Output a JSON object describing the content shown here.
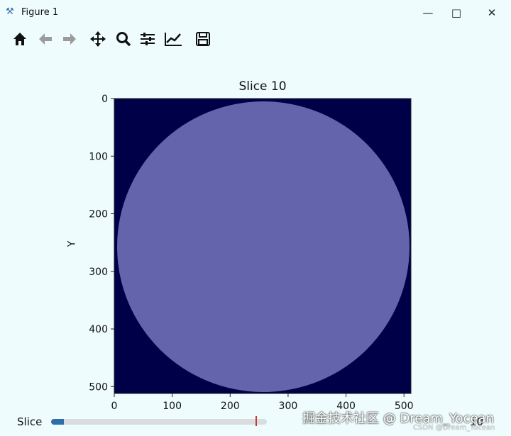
{
  "window": {
    "title": "Figure 1",
    "app_icon": "matplotlib-icon",
    "controls": [
      "minimize-icon",
      "maximize-icon",
      "close-icon"
    ]
  },
  "toolbar": {
    "buttons": [
      "home-icon",
      "back-icon",
      "forward-icon",
      "pan-icon",
      "zoom-icon",
      "configure-subplots-icon",
      "edit-axis-icon",
      "save-icon"
    ]
  },
  "figure": {
    "title": "Slice 10",
    "ylabel": "Y"
  },
  "chart_data": {
    "type": "heatmap",
    "title": "Slice 10",
    "xlabel": "",
    "ylabel": "Y",
    "xlim": [
      0,
      512
    ],
    "ylim": [
      512,
      0
    ],
    "xticks": [
      0,
      100,
      200,
      300,
      400,
      500
    ],
    "yticks": [
      0,
      100,
      200,
      300,
      400,
      500
    ],
    "description_colors": {
      "background": "#000048",
      "disk": "#6464ac"
    },
    "colormap": "dark navy outside, lavender-blue circular disk filling the image"
  },
  "slider": {
    "label": "Slice",
    "value": "10",
    "fraction": 0.06
  },
  "watermark": {
    "main": "掘金技术社区 @ Dream_Yocean",
    "sub": "CSDN @Dream_Yocean"
  }
}
